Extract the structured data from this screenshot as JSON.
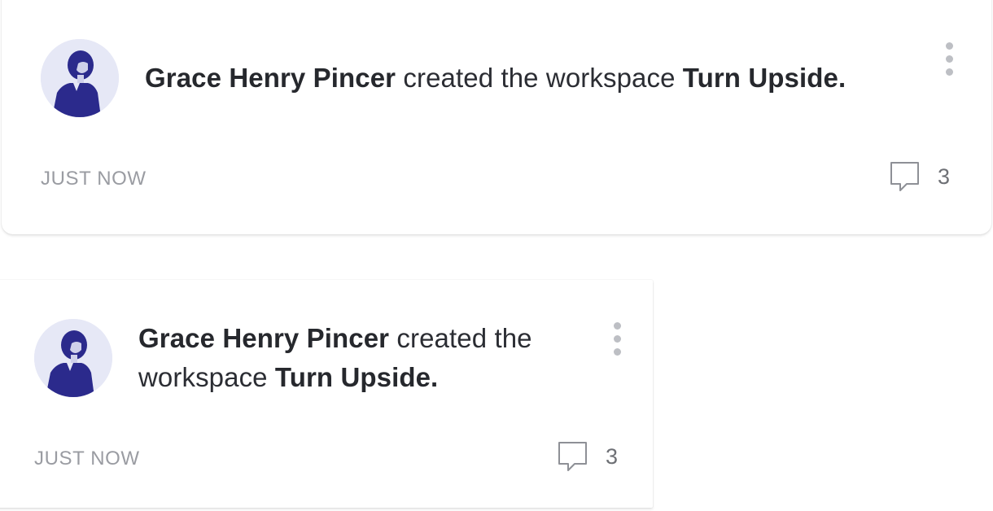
{
  "feed": [
    {
      "author": "Grace Henry Pincer",
      "action": " created the workspace ",
      "workspace": "Turn Upside.",
      "timestamp": "JUST NOW",
      "comment_count": "3"
    },
    {
      "author": "Grace Henry Pincer",
      "action": " created the workspace ",
      "workspace": "Turn Upside.",
      "timestamp": "JUST NOW",
      "comment_count": "3"
    }
  ],
  "icons": {
    "avatar": "user-photo",
    "comment": "comment-bubble-icon",
    "more": "vertical-ellipsis-icon"
  },
  "colors": {
    "avatar_tint": "#2b2a8c",
    "avatar_background": "#e6e8f6",
    "text_primary": "#2b2d33",
    "text_muted": "#9a9ca2",
    "dots": "#bdbfc4"
  }
}
